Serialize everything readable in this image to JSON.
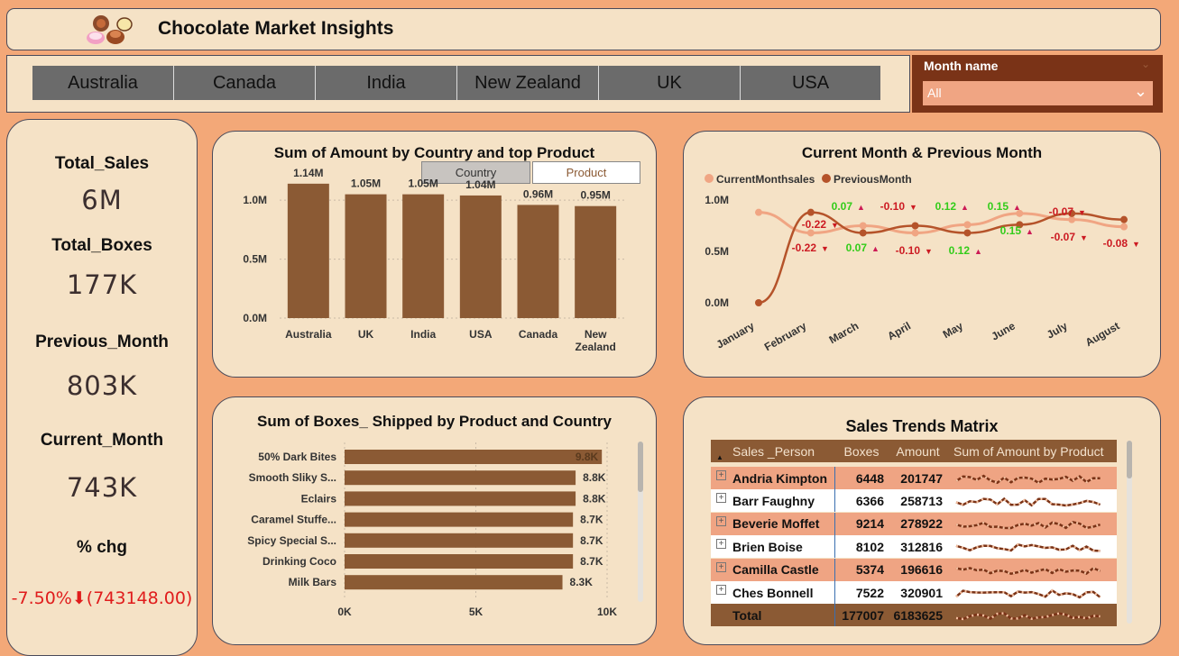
{
  "header": {
    "title": "Chocolate Market Insights",
    "logo_icon": "chocolate-logo-icon"
  },
  "country_slicer": [
    "Australia",
    "Canada",
    "India",
    "New Zealand",
    "UK",
    "USA"
  ],
  "month_filter": {
    "label": "Month name",
    "value": "All"
  },
  "kpis": {
    "total_sales_label": "Total_Sales",
    "total_sales_value": "6M",
    "total_boxes_label": "Total_Boxes",
    "total_boxes_value": "177K",
    "previous_month_label": "Previous_Month",
    "previous_month_value": "803K",
    "current_month_label": "Current_Month",
    "current_month_value": "743K",
    "pct_chg_label": "% chg",
    "pct_chg_value": "-7.50%⬇(743148.00)"
  },
  "colors": {
    "bar": "#8b5a34",
    "background": "#f3a878",
    "panel": "#f5e2c6",
    "current_line": "#f0a583",
    "previous_line": "#b5532a",
    "positive": "#33cc1a",
    "negative": "#cc1a22"
  },
  "chart_data": [
    {
      "type": "bar",
      "title": "Sum of Amount by Country and top Product",
      "toggle": [
        "Country",
        "Product"
      ],
      "categories": [
        "Australia",
        "UK",
        "India",
        "USA",
        "Canada",
        "New Zealand"
      ],
      "values": [
        1.14,
        1.05,
        1.05,
        1.04,
        0.96,
        0.95
      ],
      "data_labels": [
        "1.14M",
        "1.05M",
        "1.05M",
        "1.04M",
        "0.96M",
        "0.95M"
      ],
      "yticks": [
        "0.0M",
        "0.5M",
        "1.0M"
      ],
      "ylim": [
        0,
        1.2
      ]
    },
    {
      "type": "line",
      "title": "Current Month & Previous Month",
      "x": [
        "January",
        "February",
        "March",
        "April",
        "May",
        "June",
        "July",
        "August"
      ],
      "series": [
        {
          "name": "CurrentMonthsales",
          "values": [
            0.88,
            0.68,
            0.75,
            0.68,
            0.76,
            0.87,
            0.81,
            0.74
          ]
        },
        {
          "name": "PreviousMonth",
          "values": [
            0.0,
            0.88,
            0.68,
            0.75,
            0.68,
            0.76,
            0.87,
            0.81
          ]
        }
      ],
      "change_labels_top": [
        "-0.22",
        "0.07",
        "-0.10",
        "0.12",
        "0.15",
        "-0.07"
      ],
      "change_labels_bottom": [
        "-0.22",
        "0.07",
        "-0.10",
        "0.12",
        "0.15",
        "-0.07",
        "-0.08"
      ],
      "yticks": [
        "0.0M",
        "0.5M",
        "1.0M"
      ],
      "ylim": [
        0,
        1.0
      ],
      "legend": "top-left"
    },
    {
      "type": "bar",
      "orientation": "horizontal",
      "title": "Sum of Boxes_ Shipped by Product and Country",
      "categories": [
        "50% Dark Bites",
        "Smooth Sliky S...",
        "Eclairs",
        "Caramel Stuffe...",
        "Spicy Special S...",
        "Drinking Coco",
        "Milk Bars"
      ],
      "values": [
        9.8,
        8.8,
        8.8,
        8.7,
        8.7,
        8.7,
        8.3
      ],
      "data_labels": [
        "9.8K",
        "8.8K",
        "8.8K",
        "8.7K",
        "8.7K",
        "8.7K",
        "8.3K"
      ],
      "xticks": [
        "0K",
        "5K",
        "10K"
      ],
      "xlim": [
        0,
        10
      ]
    }
  ],
  "matrix": {
    "title": "Sales Trends Matrix",
    "columns": [
      "Sales _Person",
      "Boxes",
      "Amount",
      "Sum of Amount by Product"
    ],
    "rows": [
      {
        "name": "Andria Kimpton",
        "boxes": "6448",
        "amount": "201747"
      },
      {
        "name": "Barr Faughny",
        "boxes": "6366",
        "amount": "258713"
      },
      {
        "name": "Beverie Moffet",
        "boxes": "9214",
        "amount": "278922"
      },
      {
        "name": "Brien Boise",
        "boxes": "8102",
        "amount": "312816"
      },
      {
        "name": "Camilla Castle",
        "boxes": "5374",
        "amount": "196616"
      },
      {
        "name": "Ches Bonnell",
        "boxes": "7522",
        "amount": "320901"
      }
    ],
    "total": {
      "name": "Total",
      "boxes": "177007",
      "amount": "6183625"
    }
  }
}
